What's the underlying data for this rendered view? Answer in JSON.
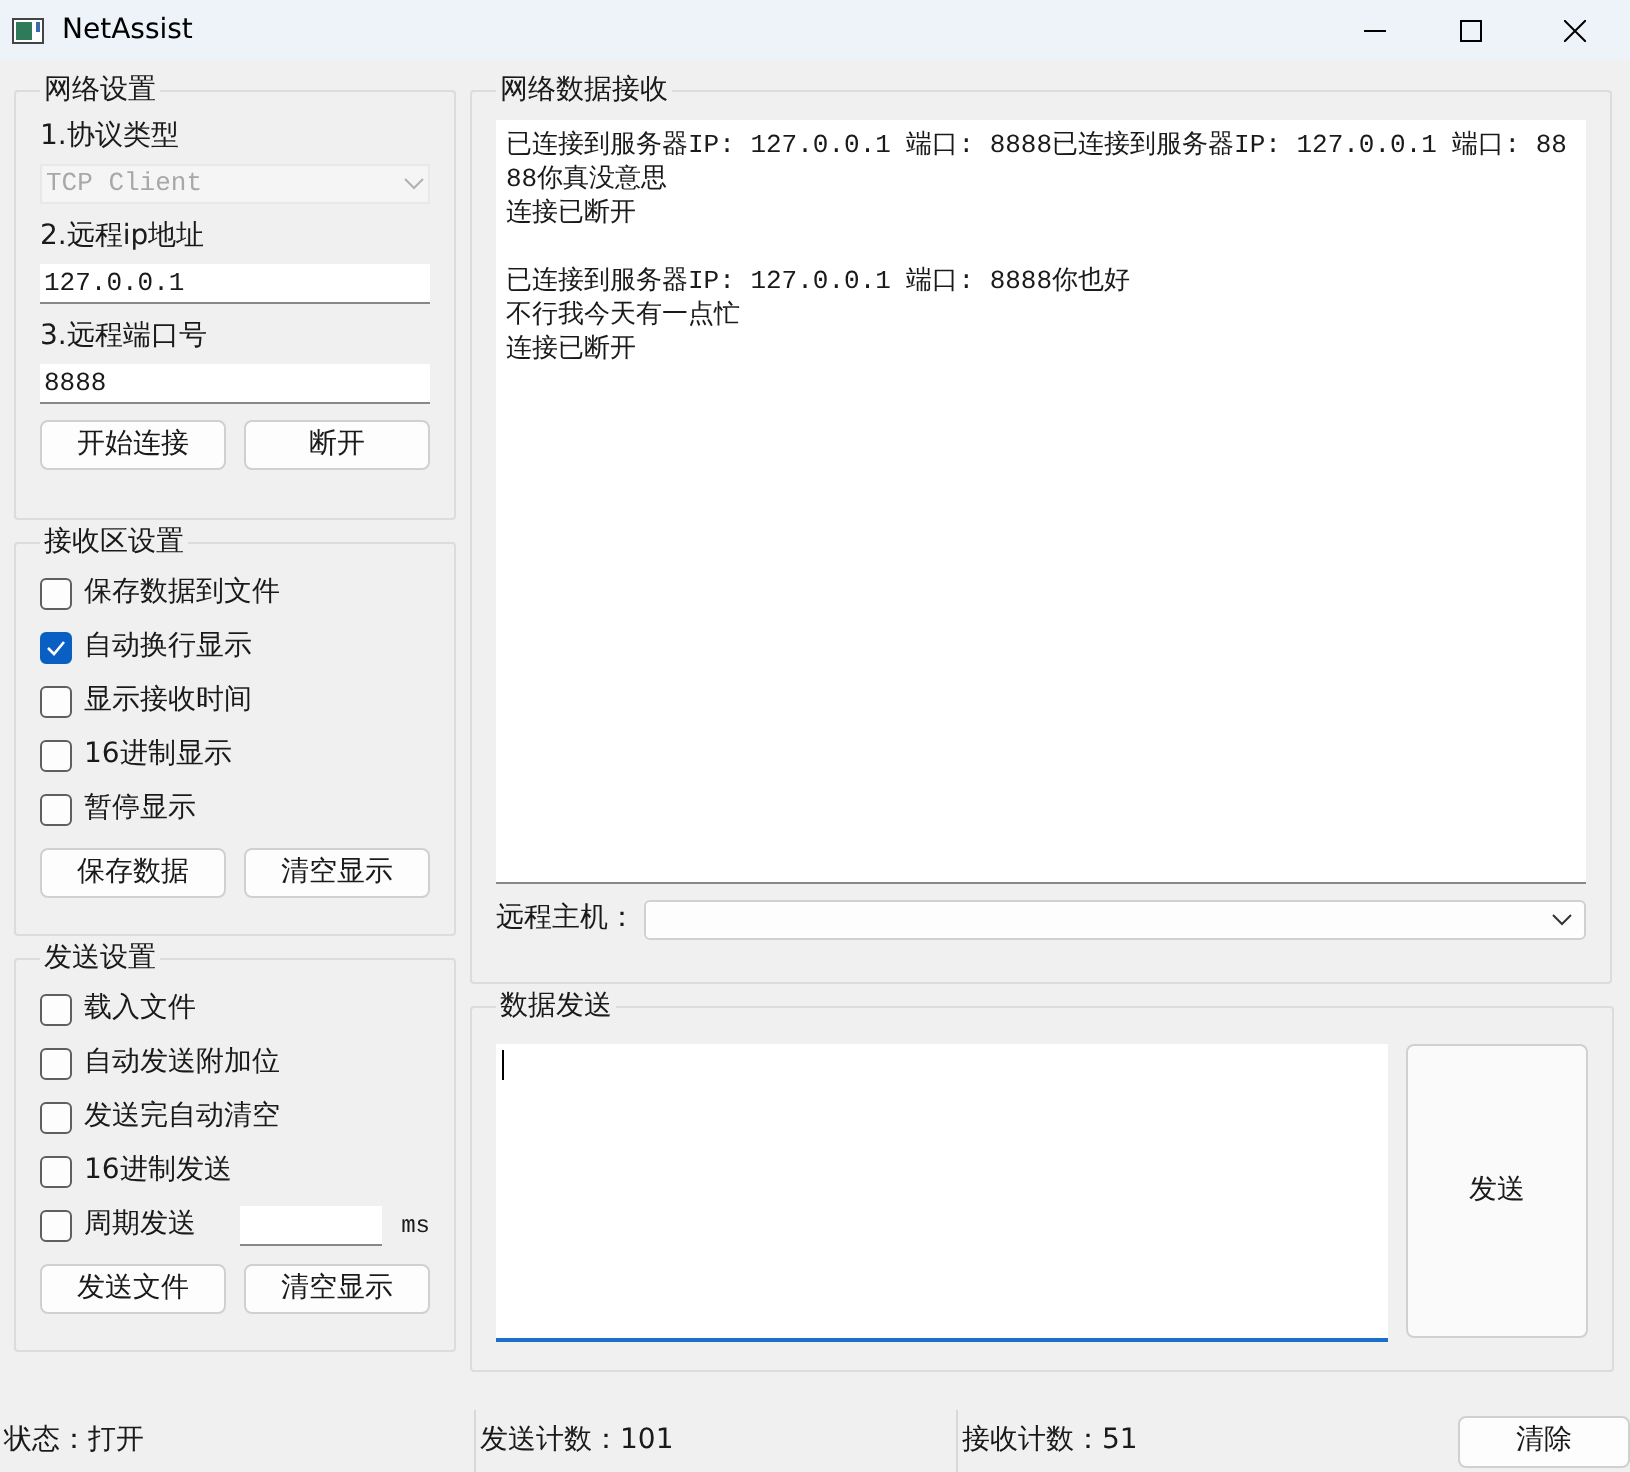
{
  "window": {
    "title": "NetAssist"
  },
  "network_settings": {
    "title": "网络设置",
    "protocol_label": "1.协议类型",
    "protocol": {
      "value": "TCP Client",
      "disabled": true
    },
    "ip_label": "2.远程ip地址",
    "ip": "127.0.0.1",
    "port_label": "3.远程端口号",
    "port": "8888",
    "buttons": [
      "开始连接",
      "断开"
    ]
  },
  "receive_settings": {
    "title": "接收区设置",
    "options": [
      {
        "label": "保存数据到文件",
        "checked": false
      },
      {
        "label": "自动换行显示",
        "checked": true
      },
      {
        "label": "显示接收时间",
        "checked": false
      },
      {
        "label": "16进制显示",
        "checked": false
      },
      {
        "label": "暂停显示",
        "checked": false
      }
    ],
    "buttons": [
      "保存数据",
      "清空显示"
    ]
  },
  "send_settings": {
    "title": "发送设置",
    "options": [
      {
        "label": "载入文件",
        "checked": false
      },
      {
        "label": "自动发送附加位",
        "checked": false
      },
      {
        "label": "发送完自动清空",
        "checked": false
      },
      {
        "label": "16进制发送",
        "checked": false
      }
    ],
    "period": {
      "label": "周期发送",
      "checked": false,
      "unit": "ms"
    },
    "buttons": [
      "发送文件",
      "清空显示"
    ]
  },
  "receive": {
    "title": "网络数据接收",
    "messages": [
      [
        "已连接到服务器IP: 127.0.0.1 端口: 8888已连接到服务器IP: 127.0.0.1 端口: 8888你真没意思",
        "连接已断开"
      ],
      [
        "已连接到服务器IP: 127.0.0.1 端口: 8888你也好",
        "不行我今天有一点忙",
        "连接已断开"
      ]
    ],
    "remote_host_label": "远程主机："
  },
  "send": {
    "title": "数据发送",
    "button": "发送"
  },
  "status_bar": {
    "fields": [
      "状态：打开",
      "发送计数：101",
      "接收计数：51"
    ],
    "clear_button": "清除"
  }
}
